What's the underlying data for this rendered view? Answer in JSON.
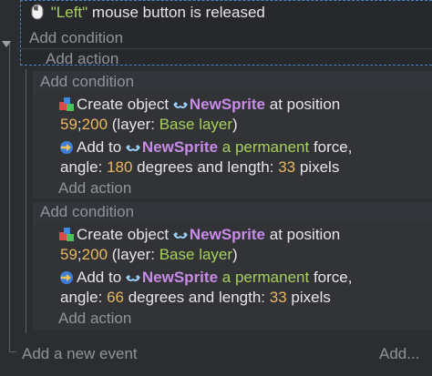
{
  "top_event": {
    "condition_quote_open": "\"",
    "condition_string": "Left",
    "condition_quote_close": "\"",
    "condition_text": " mouse button is released",
    "add_condition": "Add condition",
    "add_action": "Add action"
  },
  "sub_events": [
    {
      "add_condition": "Add condition",
      "action1": {
        "prefix": "Create object",
        "object": "NewSprite",
        "mid": "at position",
        "x": "59",
        "sep": ";",
        "y": "200",
        "layer_open": " (layer: ",
        "layer": "Base layer",
        "layer_close": ")"
      },
      "action2": {
        "prefix": "Add to",
        "object": "NewSprite",
        "kind": "a permanent",
        "force": "force,",
        "angle_label": "angle:",
        "angle": "180",
        "length_label": "degrees and length:",
        "length": "33",
        "unit": "pixels"
      },
      "add_action": "Add action"
    },
    {
      "add_condition": "Add condition",
      "action1": {
        "prefix": "Create object",
        "object": "NewSprite",
        "mid": "at position",
        "x": "59",
        "sep": ";",
        "y": "200",
        "layer_open": " (layer: ",
        "layer": "Base layer",
        "layer_close": ")"
      },
      "action2": {
        "prefix": "Add to",
        "object": "NewSprite",
        "kind": "a permanent",
        "force": "force,",
        "angle_label": "angle:",
        "angle": "66",
        "length_label": "degrees and length:",
        "length": "33",
        "unit": "pixels"
      },
      "add_action": "Add action"
    }
  ],
  "footer": {
    "add_event": "Add a new event",
    "more": "Add..."
  },
  "colors": {
    "background": "#2b2d31",
    "string": "#a6d05a",
    "number": "#e9b85f",
    "object": "#c98be8",
    "selection": "#4a86c5"
  },
  "icons": [
    "mouse-icon",
    "create-object-icon",
    "sprite-icon",
    "force-icon",
    "collapse-arrow-icon"
  ]
}
